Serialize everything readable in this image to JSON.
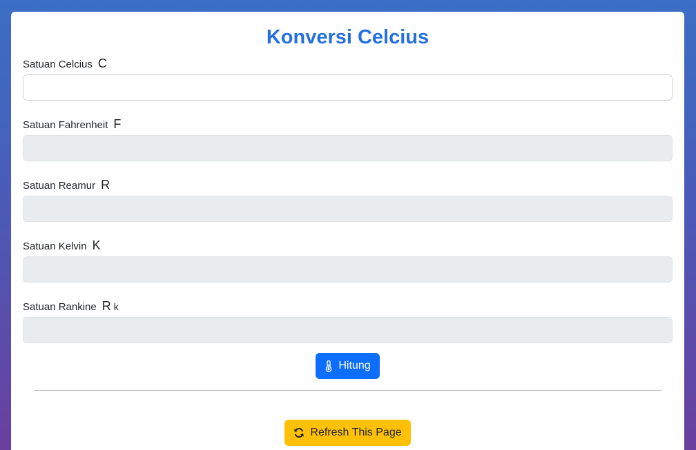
{
  "page": {
    "title": "Konversi Celcius"
  },
  "fields": [
    {
      "label": "Satuan Celcius",
      "unit": "C",
      "unit_sub": "",
      "value": "",
      "readonly": false
    },
    {
      "label": "Satuan Fahrenheit",
      "unit": "F",
      "unit_sub": "",
      "value": "",
      "readonly": true
    },
    {
      "label": "Satuan Reamur",
      "unit": "R",
      "unit_sub": "",
      "value": "",
      "readonly": true
    },
    {
      "label": "Satuan Kelvin",
      "unit": "K",
      "unit_sub": "",
      "value": "",
      "readonly": true
    },
    {
      "label": "Satuan Rankine",
      "unit": "R",
      "unit_sub": "k",
      "value": "",
      "readonly": true
    }
  ],
  "buttons": {
    "calculate_label": "Hitung",
    "calculate_icon": "thermometer-icon",
    "refresh_label": "Refresh This Page",
    "refresh_icon": "refresh-icon"
  },
  "colors": {
    "title": "#2470e0",
    "primary": "#0d6efd",
    "warning": "#ffc107",
    "readonly_bg": "#e9ecef"
  }
}
